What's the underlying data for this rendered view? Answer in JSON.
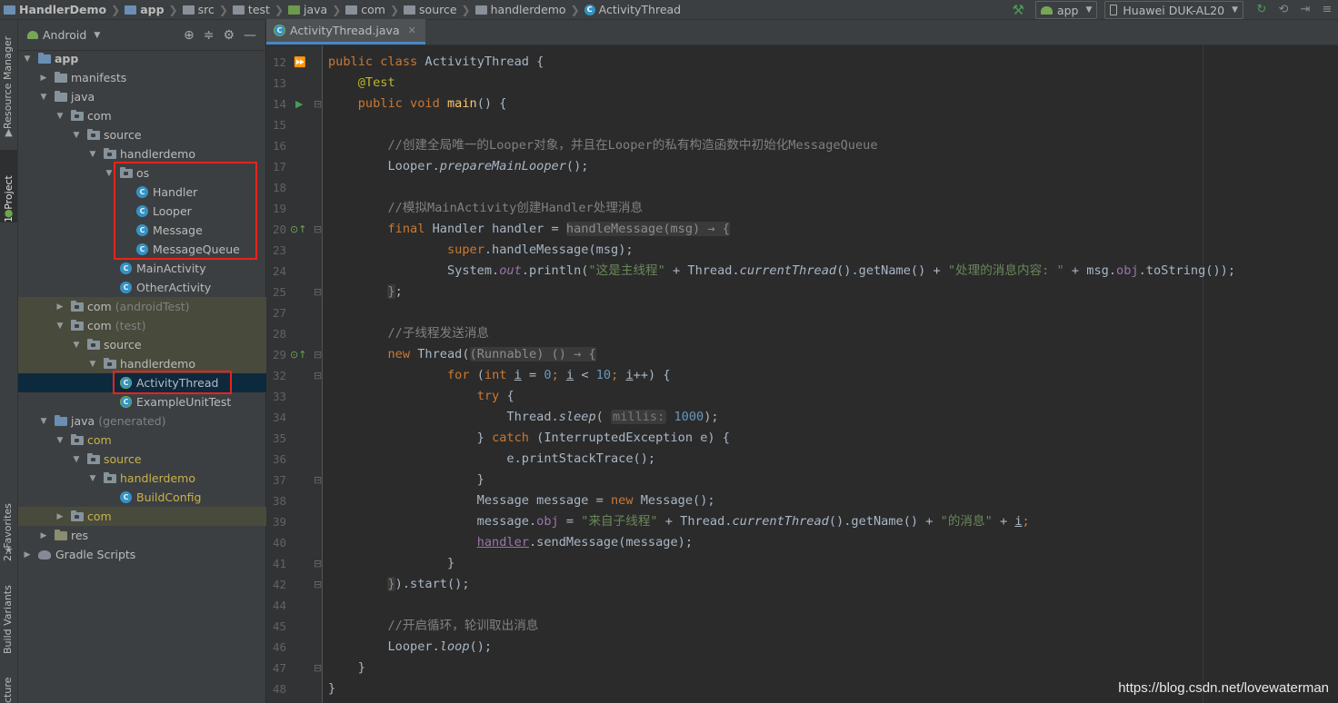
{
  "breadcrumb": {
    "items": [
      "HandlerDemo",
      "app",
      "src",
      "test",
      "java",
      "com",
      "source",
      "handlerdemo",
      "ActivityThread"
    ]
  },
  "toolbar": {
    "run_config": "app",
    "device": "Huawei DUK-AL20"
  },
  "side_tabs": {
    "resource_manager": "Resource Manager",
    "project": "1: Project",
    "favorites": "2: Favorites",
    "build_variants": "Build Variants",
    "structure": "cture"
  },
  "project_panel": {
    "view_mode": "Android",
    "tree": [
      {
        "label": "app",
        "extra": "",
        "depth": 0,
        "expanded": true,
        "icon": "module-folder-icon"
      },
      {
        "label": "manifests",
        "extra": "",
        "depth": 1,
        "expanded": false,
        "icon": "folder-icon"
      },
      {
        "label": "java",
        "extra": "",
        "depth": 1,
        "expanded": true,
        "icon": "folder-icon"
      },
      {
        "label": "com",
        "extra": "",
        "depth": 2,
        "expanded": true,
        "icon": "package-icon"
      },
      {
        "label": "source",
        "extra": "",
        "depth": 3,
        "expanded": true,
        "icon": "package-icon"
      },
      {
        "label": "handlerdemo",
        "extra": "",
        "depth": 4,
        "expanded": true,
        "icon": "package-icon"
      },
      {
        "label": "os",
        "extra": "",
        "depth": 5,
        "expanded": true,
        "icon": "package-icon"
      },
      {
        "label": "Handler",
        "extra": "",
        "depth": 6,
        "icon": "class-icon"
      },
      {
        "label": "Looper",
        "extra": "",
        "depth": 6,
        "icon": "class-icon"
      },
      {
        "label": "Message",
        "extra": "",
        "depth": 6,
        "icon": "class-icon"
      },
      {
        "label": "MessageQueue",
        "extra": "",
        "depth": 6,
        "icon": "class-icon"
      },
      {
        "label": "MainActivity",
        "extra": "",
        "depth": 5,
        "icon": "class-icon"
      },
      {
        "label": "OtherActivity",
        "extra": "",
        "depth": 5,
        "icon": "class-icon"
      },
      {
        "label": "com",
        "extra": "(androidTest)",
        "depth": 2,
        "expanded": false,
        "icon": "package-icon"
      },
      {
        "label": "com",
        "extra": "(test)",
        "depth": 2,
        "expanded": true,
        "icon": "package-icon"
      },
      {
        "label": "source",
        "extra": "",
        "depth": 3,
        "expanded": true,
        "icon": "package-icon"
      },
      {
        "label": "handlerdemo",
        "extra": "",
        "depth": 4,
        "expanded": true,
        "icon": "package-icon"
      },
      {
        "label": "ActivityThread",
        "extra": "",
        "depth": 5,
        "icon": "test-class-icon",
        "selected": true
      },
      {
        "label": "ExampleUnitTest",
        "extra": "",
        "depth": 5,
        "icon": "test-class-icon"
      },
      {
        "label": "java",
        "extra": "(generated)",
        "depth": 1,
        "expanded": true,
        "icon": "generated-folder-icon"
      },
      {
        "label": "com",
        "extra": "",
        "depth": 2,
        "expanded": true,
        "icon": "package-icon",
        "generated": true
      },
      {
        "label": "source",
        "extra": "",
        "depth": 3,
        "expanded": true,
        "icon": "package-icon",
        "generated": true
      },
      {
        "label": "handlerdemo",
        "extra": "",
        "depth": 4,
        "expanded": true,
        "icon": "package-icon",
        "generated": true
      },
      {
        "label": "BuildConfig",
        "extra": "",
        "depth": 5,
        "icon": "class-icon",
        "generated": true
      },
      {
        "label": "com",
        "extra": "",
        "depth": 2,
        "expanded": false,
        "icon": "package-icon",
        "generated": true
      },
      {
        "label": "res",
        "extra": "",
        "depth": 1,
        "expanded": false,
        "icon": "res-folder-icon"
      },
      {
        "label": "Gradle Scripts",
        "extra": "",
        "depth": 0,
        "expanded": false,
        "icon": "gradle-icon"
      }
    ]
  },
  "editor": {
    "tab_label": "ActivityThread.java",
    "lines": [
      {
        "n": "12",
        "tokens": [
          [
            "kw",
            "public class "
          ],
          [
            "",
            "ActivityThread {"
          ]
        ]
      },
      {
        "n": "13",
        "tokens": [
          [
            "",
            "    "
          ],
          [
            "an",
            "@Test"
          ]
        ]
      },
      {
        "n": "14",
        "tokens": [
          [
            "",
            "    "
          ],
          [
            "kw",
            "public void "
          ],
          [
            "fn",
            "main"
          ],
          [
            "",
            "() {"
          ]
        ]
      },
      {
        "n": "15",
        "tokens": []
      },
      {
        "n": "16",
        "tokens": [
          [
            "",
            "        "
          ],
          [
            "cm",
            "//创建全局唯一的Looper对象，并且在Looper的私有构造函数中初始化MessageQueue"
          ]
        ]
      },
      {
        "n": "17",
        "tokens": [
          [
            "",
            "        Looper."
          ],
          [
            "it",
            "prepareMainLooper"
          ],
          [
            "",
            "();"
          ]
        ]
      },
      {
        "n": "18",
        "tokens": []
      },
      {
        "n": "19",
        "tokens": [
          [
            "",
            "        "
          ],
          [
            "cm",
            "//模拟MainActivity创建Handler处理消息"
          ]
        ]
      },
      {
        "n": "20",
        "tokens": [
          [
            "",
            "        "
          ],
          [
            "kw",
            "final "
          ],
          [
            "",
            "Handler handler = "
          ],
          [
            "fold",
            "handleMessage(msg) → {"
          ]
        ]
      },
      {
        "n": "23",
        "tokens": [
          [
            "",
            "                "
          ],
          [
            "kw",
            "super"
          ],
          [
            "",
            ".handleMessage(msg);"
          ]
        ]
      },
      {
        "n": "24",
        "tokens": [
          [
            "",
            "                System."
          ],
          [
            "ppit",
            "out"
          ],
          [
            "",
            ".println("
          ],
          [
            "st",
            "\"这是主线程\""
          ],
          [
            "",
            " + Thread."
          ],
          [
            "it",
            "currentThread"
          ],
          [
            "",
            "().getName() + "
          ],
          [
            "st",
            "\"处理的消息内容: \""
          ],
          [
            "",
            " + msg."
          ],
          [
            "pp",
            "obj"
          ],
          [
            "",
            ".toString());"
          ]
        ]
      },
      {
        "n": "25",
        "tokens": [
          [
            "",
            "        "
          ],
          [
            "fold",
            "}"
          ],
          [
            "",
            ";"
          ]
        ]
      },
      {
        "n": "27",
        "tokens": []
      },
      {
        "n": "28",
        "tokens": [
          [
            "",
            "        "
          ],
          [
            "cm",
            "//子线程发送消息"
          ]
        ]
      },
      {
        "n": "29",
        "tokens": [
          [
            "",
            "        "
          ],
          [
            "kw",
            "new "
          ],
          [
            "",
            "Thread("
          ],
          [
            "fold",
            "(Runnable) () → {"
          ]
        ]
      },
      {
        "n": "32",
        "tokens": [
          [
            "",
            "                "
          ],
          [
            "kw",
            "for "
          ],
          [
            "",
            "("
          ],
          [
            "kw",
            "int "
          ],
          [
            "ul",
            "i"
          ],
          [
            "",
            " = "
          ],
          [
            "nm",
            "0"
          ],
          [
            "kw",
            "; "
          ],
          [
            "ul",
            "i"
          ],
          [
            "",
            " < "
          ],
          [
            "nm",
            "10"
          ],
          [
            "kw",
            "; "
          ],
          [
            "ul",
            "i"
          ],
          [
            "",
            "++) {"
          ]
        ]
      },
      {
        "n": "33",
        "tokens": [
          [
            "",
            "                    "
          ],
          [
            "kw",
            "try "
          ],
          [
            "",
            "{"
          ]
        ]
      },
      {
        "n": "34",
        "tokens": [
          [
            "",
            "                        Thread."
          ],
          [
            "it",
            "sleep"
          ],
          [
            "",
            "( "
          ],
          [
            "hint",
            "millis:"
          ],
          [
            "nm",
            " 1000"
          ],
          [
            "",
            ");"
          ]
        ]
      },
      {
        "n": "35",
        "tokens": [
          [
            "",
            "                    } "
          ],
          [
            "kw",
            "catch "
          ],
          [
            "",
            "(InterruptedException e) {"
          ]
        ]
      },
      {
        "n": "36",
        "tokens": [
          [
            "",
            "                        e.printStackTrace();"
          ]
        ]
      },
      {
        "n": "37",
        "tokens": [
          [
            "",
            "                    }"
          ]
        ]
      },
      {
        "n": "38",
        "tokens": [
          [
            "",
            "                    Message message = "
          ],
          [
            "kw",
            "new "
          ],
          [
            "",
            "Message();"
          ]
        ]
      },
      {
        "n": "39",
        "tokens": [
          [
            "",
            "                    message."
          ],
          [
            "pp",
            "obj"
          ],
          [
            "",
            " = "
          ],
          [
            "st",
            "\"来自子线程\""
          ],
          [
            "",
            " + Thread."
          ],
          [
            "it",
            "currentThread"
          ],
          [
            "",
            "().getName() + "
          ],
          [
            "st",
            "\"的消息\""
          ],
          [
            "",
            " + "
          ],
          [
            "ul",
            "i"
          ],
          [
            "kw",
            ";"
          ]
        ]
      },
      {
        "n": "40",
        "tokens": [
          [
            "",
            "                    "
          ],
          [
            "ppul",
            "handler"
          ],
          [
            "",
            ".sendMessage(message);"
          ]
        ]
      },
      {
        "n": "41",
        "tokens": [
          [
            "",
            "                }"
          ]
        ]
      },
      {
        "n": "42",
        "tokens": [
          [
            "",
            "        "
          ],
          [
            "fold",
            "}"
          ],
          [
            "",
            ").start();"
          ]
        ]
      },
      {
        "n": "44",
        "tokens": []
      },
      {
        "n": "45",
        "tokens": [
          [
            "",
            "        "
          ],
          [
            "cm",
            "//开启循环，轮训取出消息"
          ]
        ]
      },
      {
        "n": "46",
        "tokens": [
          [
            "",
            "        Looper."
          ],
          [
            "it",
            "loop"
          ],
          [
            "",
            "();"
          ]
        ]
      },
      {
        "n": "47",
        "tokens": [
          [
            "",
            "    }"
          ]
        ]
      },
      {
        "n": "48",
        "tokens": [
          [
            "",
            "}"
          ]
        ]
      }
    ]
  },
  "watermark": "https://blog.csdn.net/lovewaterman",
  "colors": {
    "keyword": "#cc7832",
    "annotation": "#bbb529",
    "function": "#ffc66d",
    "comment": "#808080",
    "string": "#6a8759",
    "number": "#6897bb",
    "field": "#9876aa",
    "highlight_box": "#e8231c"
  }
}
